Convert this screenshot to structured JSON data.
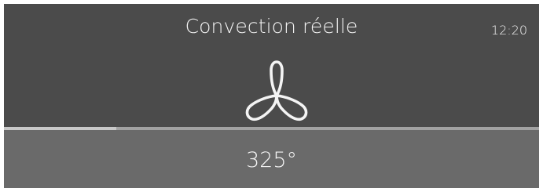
{
  "display": {
    "mode_title": "Convection réelle",
    "clock": "12:20",
    "temperature": "325°",
    "progress_fraction": 0.21,
    "icon": "fan-icon"
  },
  "colors": {
    "top_panel": "#4b4b4b",
    "bottom_panel": "#6a6a6a",
    "text": "#f4f4f4",
    "progress_fill": "#c8c8c8",
    "progress_track": "#a2a2a2"
  }
}
